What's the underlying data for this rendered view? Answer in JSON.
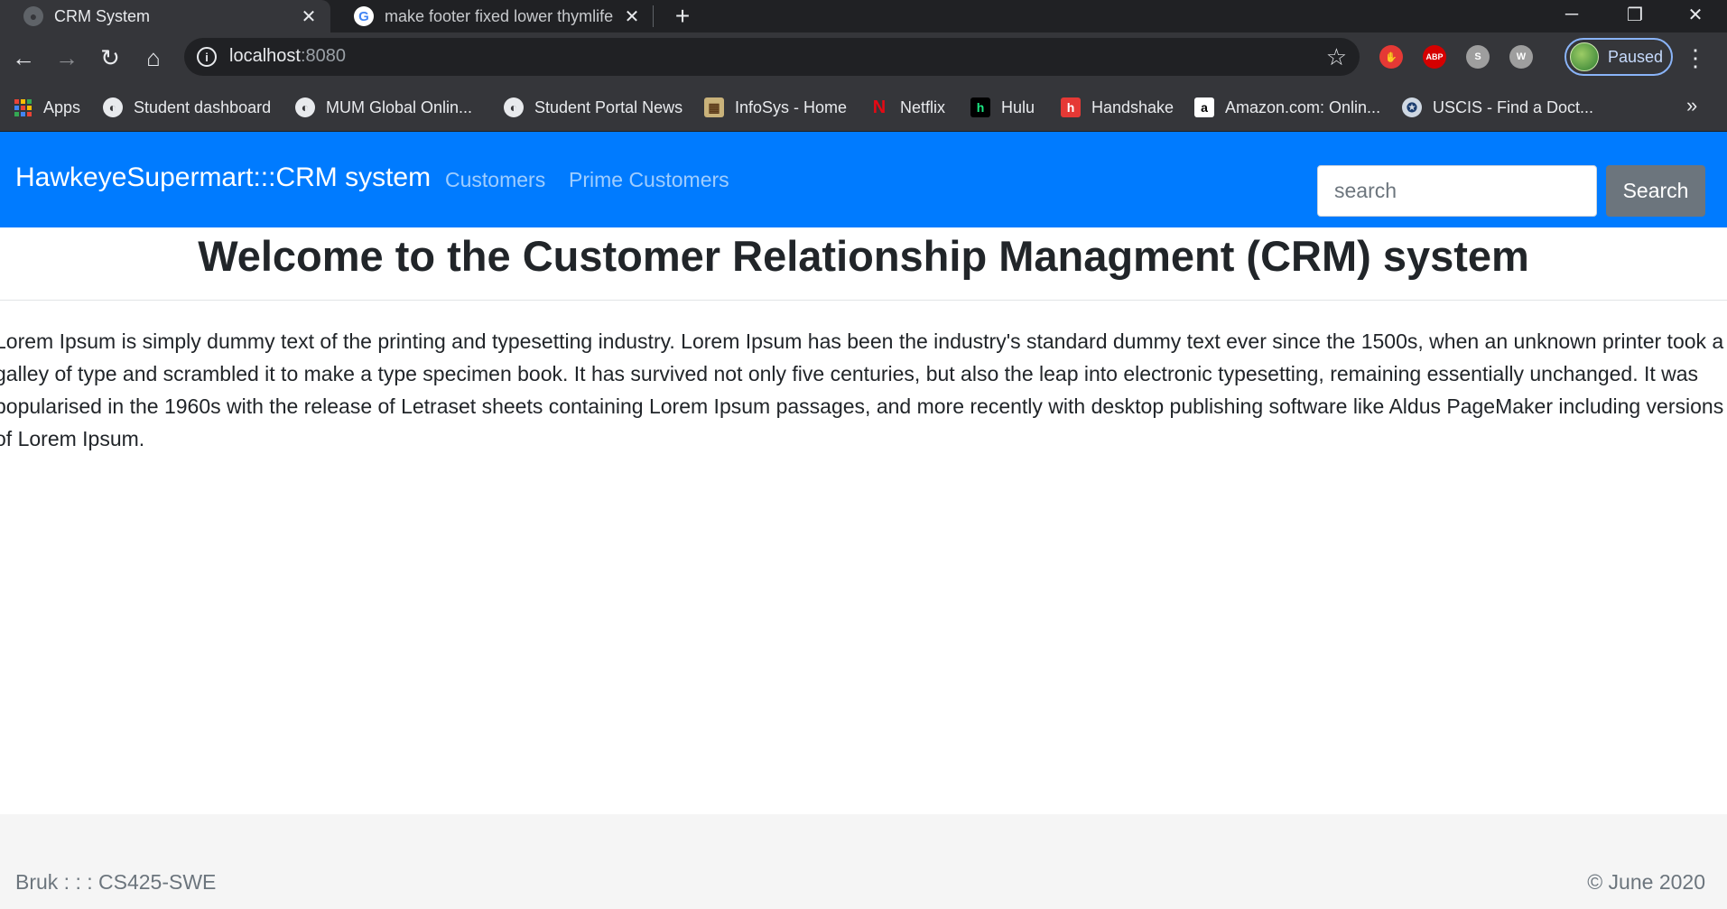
{
  "browser": {
    "tabs": [
      {
        "title": "CRM System",
        "active": true
      },
      {
        "title": "make footer fixed lower thymlife",
        "active": false
      }
    ],
    "address": {
      "host": "localhost",
      "port": ":8080"
    },
    "profile_label": "Paused",
    "extensions": [
      {
        "name": "adblock-stop",
        "label": "",
        "color": "#e53935"
      },
      {
        "name": "abp",
        "label": "ABP",
        "color": "#d50000"
      },
      {
        "name": "skype",
        "label": "S",
        "color": "#9e9e9e"
      },
      {
        "name": "w-ext",
        "label": "W",
        "color": "#9e9e9e"
      }
    ],
    "bookmarks": [
      {
        "label": "Apps"
      },
      {
        "label": "Student dashboard"
      },
      {
        "label": "MUM Global Onlin..."
      },
      {
        "label": "Student Portal News"
      },
      {
        "label": "InfoSys - Home"
      },
      {
        "label": "Netflix"
      },
      {
        "label": "Hulu"
      },
      {
        "label": "Handshake"
      },
      {
        "label": "Amazon.com: Onlin..."
      },
      {
        "label": "USCIS - Find a Doct..."
      }
    ]
  },
  "navbar": {
    "brand": "HawkeyeSupermart:::CRM system",
    "links": [
      "Customers",
      "Prime Customers"
    ],
    "search_placeholder": "search",
    "search_button": "Search",
    "background": "#007bff"
  },
  "main": {
    "heading": "Welcome to the Customer Relationship Managment (CRM) system",
    "paragraph": "Lorem Ipsum is simply dummy text of the printing and typesetting industry. Lorem Ipsum has been the industry's standard dummy text ever since the 1500s, when an unknown printer took a galley of type and scrambled it to make a type specimen book. It has survived not only five centuries, but also the leap into electronic typesetting, remaining essentially unchanged. It was popularised in the 1960s with the release of Letraset sheets containing Lorem Ipsum passages, and more recently with desktop publishing software like Aldus PageMaker including versions of Lorem Ipsum."
  },
  "footer": {
    "left": "Bruk : : : CS425-SWE",
    "right": "© June 2020"
  }
}
